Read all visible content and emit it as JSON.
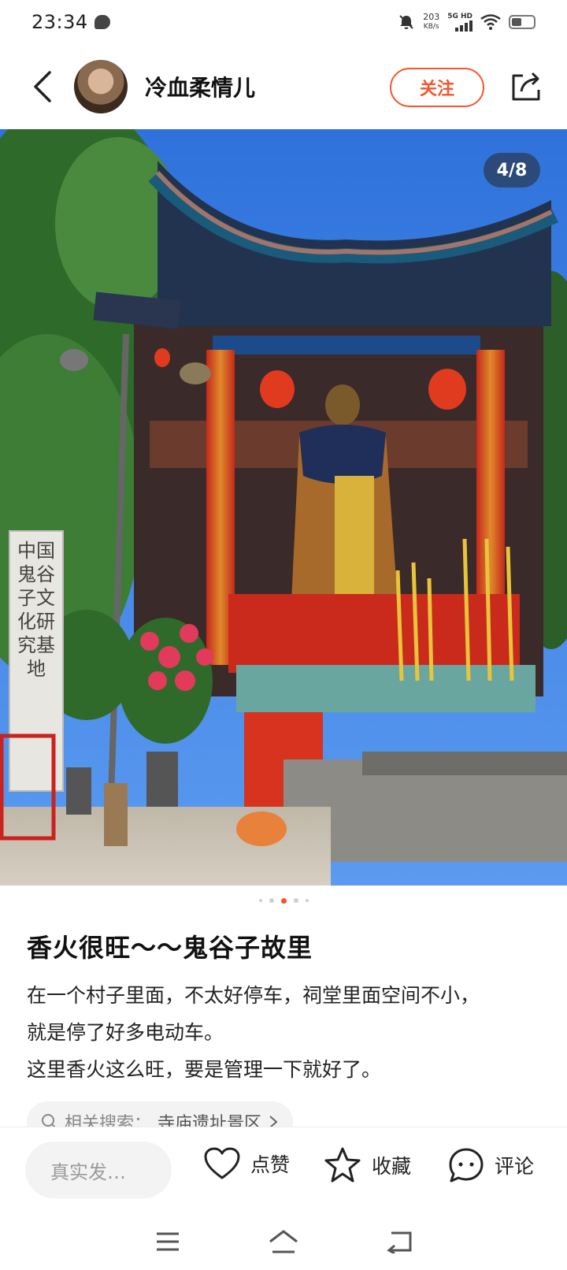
{
  "status_bar": {
    "time": "23:34",
    "net_speed_value": "203",
    "net_speed_unit": "KB/s",
    "network_type": "5G HD"
  },
  "header": {
    "user_name": "冷血柔情儿",
    "follow_label": "关注"
  },
  "gallery": {
    "counter": "4/8",
    "stone_tablet_text": "中国鬼谷子文化研究基地",
    "dots_total": 5,
    "dots_active_index": 2
  },
  "post": {
    "title": "香火很旺～～鬼谷子故里",
    "body_line_1": "在一个村子里面，不太好停车，祠堂里面空间不小，",
    "body_line_2": "就是停了好多电动车。",
    "body_line_3": "这里香火这么旺，要是管理一下就好了。",
    "related_label": "相关搜索：",
    "related_value": "寺庙遗址景区"
  },
  "actions": {
    "comment_placeholder": "真实发…",
    "like_label": "点赞",
    "collect_label": "收藏",
    "comment_label": "评论"
  },
  "colors": {
    "accent": "#f3552e",
    "sky": "#3a7fe0"
  }
}
